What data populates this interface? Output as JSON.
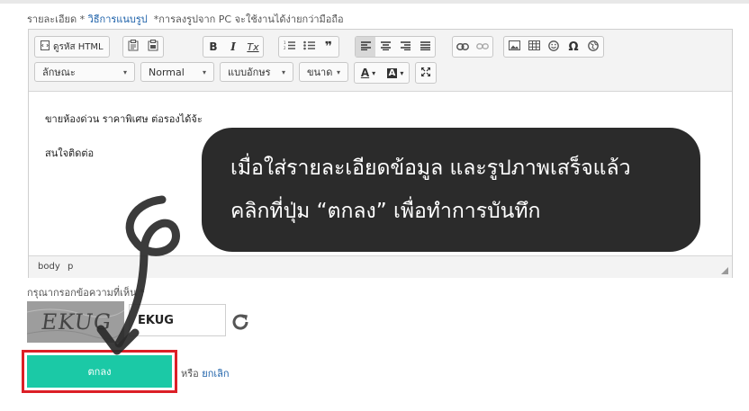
{
  "detail_label": {
    "label": "รายละเอียด",
    "required_mark": "*",
    "howto_link": "วิธีการแนบรูป",
    "note": "*การลงรูปจาก PC จะใช้งานได้ง่ายกว่ามือถือ"
  },
  "toolbar": {
    "source_label": "ดูรหัส HTML",
    "bold_label": "B",
    "italic_label": "I",
    "clear_format_label": "Tx",
    "blockquote_label": "❞",
    "special_char_label": "Ω",
    "style_combo": "ลักษณะ",
    "format_combo": "Normal",
    "font_combo": "แบบอักษร",
    "size_combo": "ขนาด",
    "text_color_label": "A",
    "bg_color_label": "A"
  },
  "content": {
    "lines": [
      "ขายห้องด่วน ราคาพิเศษ ต่อรองได้จ้ะ",
      "สนใจติดต่อ"
    ]
  },
  "statusbar": {
    "path_body": "body",
    "path_p": "p"
  },
  "callout": {
    "line1": "เมื่อใส่รายละเอียดข้อมูล และรูปภาพเสร็จแล้ว",
    "line2": "คลิกที่ปุ่ม “ตกลง” เพื่อทำการบันทึก"
  },
  "captcha": {
    "label": "กรุณากรอกข้อความที่เห็น *",
    "image_text": "EKUG",
    "input_value": "EKUG"
  },
  "actions": {
    "ok_label": "ตกลง",
    "or_label": "หรือ",
    "cancel_label": "ยกเลิก"
  },
  "colors": {
    "ok_button": "#1bc9a6",
    "highlight_border": "#dc1f26",
    "callout_bg": "#2b2b2b",
    "link": "#1a5fa8"
  }
}
